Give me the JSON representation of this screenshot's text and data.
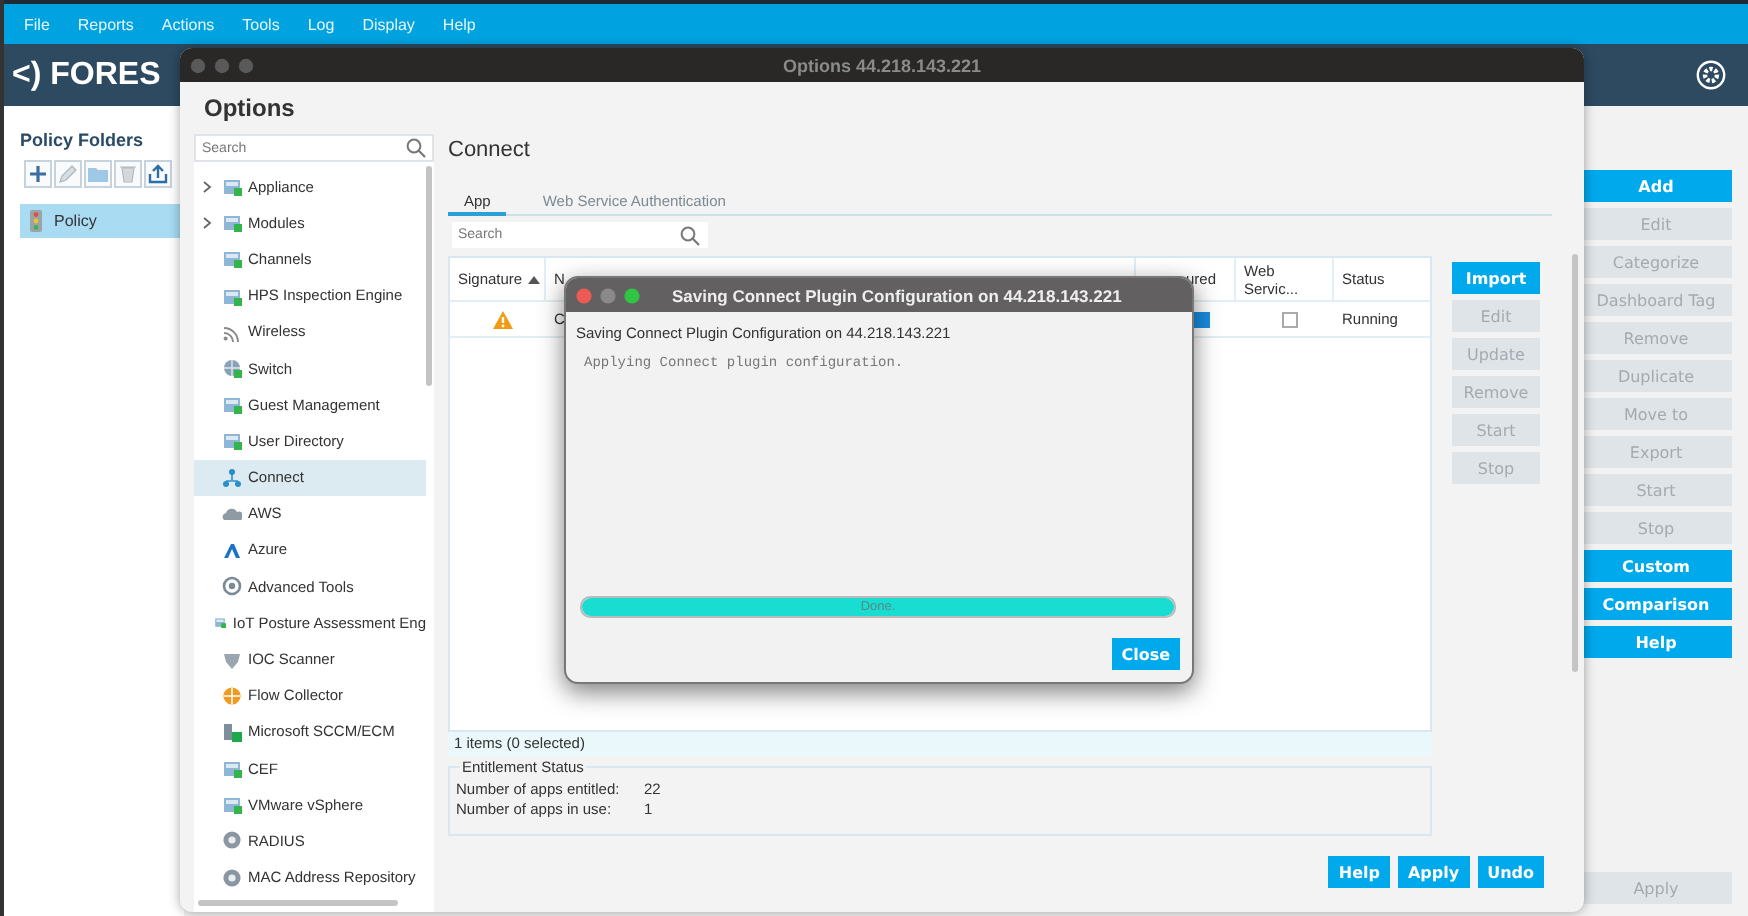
{
  "menu": [
    {
      "label": "File"
    },
    {
      "label": "Reports"
    },
    {
      "label": "Actions"
    },
    {
      "label": "Tools"
    },
    {
      "label": "Log"
    },
    {
      "label": "Display"
    },
    {
      "label": "Help"
    }
  ],
  "logo": "<) FORES",
  "policy_panel": {
    "title": "Policy Folders",
    "items": [
      {
        "label": "Policy",
        "selected": true
      }
    ]
  },
  "side_buttons": [
    {
      "label": "Add",
      "disabled": false
    },
    {
      "label": "Edit",
      "disabled": true
    },
    {
      "label": "Categorize",
      "disabled": true
    },
    {
      "label": "Dashboard Tag",
      "disabled": true
    },
    {
      "label": "Remove",
      "disabled": true
    },
    {
      "label": "Duplicate",
      "disabled": true
    },
    {
      "label": "Move to",
      "disabled": true
    },
    {
      "label": "Export",
      "disabled": true
    },
    {
      "label": "Start",
      "disabled": true
    },
    {
      "label": "Stop",
      "disabled": true
    },
    {
      "label": "Custom",
      "disabled": false
    },
    {
      "label": "Comparison",
      "disabled": false
    },
    {
      "label": "Help",
      "disabled": false
    }
  ],
  "apply_button": {
    "label": "Apply",
    "disabled": true
  },
  "options_window": {
    "title": "Options 44.218.143.221",
    "heading": "Options",
    "nav_search": {
      "placeholder": "Search"
    },
    "nav_items": [
      {
        "label": "Appliance",
        "expandable": true,
        "selected": false
      },
      {
        "label": "Modules",
        "expandable": true,
        "selected": false
      },
      {
        "label": "Channels",
        "expandable": false,
        "selected": false
      },
      {
        "label": "HPS Inspection Engine",
        "expandable": false,
        "selected": false
      },
      {
        "label": "Wireless",
        "expandable": false,
        "selected": false
      },
      {
        "label": "Switch",
        "expandable": false,
        "selected": false
      },
      {
        "label": "Guest Management",
        "expandable": false,
        "selected": false
      },
      {
        "label": "User Directory",
        "expandable": false,
        "selected": false
      },
      {
        "label": "Connect",
        "expandable": false,
        "selected": true
      },
      {
        "label": "AWS",
        "expandable": false,
        "selected": false
      },
      {
        "label": "Azure",
        "expandable": false,
        "selected": false
      },
      {
        "label": "Advanced Tools",
        "expandable": false,
        "selected": false
      },
      {
        "label": "IoT Posture Assessment Eng",
        "expandable": false,
        "selected": false
      },
      {
        "label": "IOC Scanner",
        "expandable": false,
        "selected": false
      },
      {
        "label": "Flow Collector",
        "expandable": false,
        "selected": false
      },
      {
        "label": "Microsoft SCCM/ECM",
        "expandable": false,
        "selected": false
      },
      {
        "label": "CEF",
        "expandable": false,
        "selected": false
      },
      {
        "label": "VMware vSphere",
        "expandable": false,
        "selected": false
      },
      {
        "label": "RADIUS",
        "expandable": false,
        "selected": false
      },
      {
        "label": "MAC Address Repository",
        "expandable": false,
        "selected": false
      }
    ],
    "section_title": "Connect",
    "tabs": [
      {
        "label": "App",
        "selected": true
      },
      {
        "label": "Web Service Authentication",
        "selected": false
      }
    ],
    "search": {
      "placeholder": "Search"
    },
    "table": {
      "columns": [
        {
          "label": "Signature"
        },
        {
          "label": "N"
        },
        {
          "label": "ured"
        },
        {
          "label": "Web Servic..."
        },
        {
          "label": "Status"
        }
      ],
      "rows": [
        {
          "name": "C",
          "configured": true,
          "web_service": false,
          "status": "Running"
        }
      ],
      "footer": "1 items (0 selected)"
    },
    "entitlement": {
      "title": "Entitlement Status",
      "rows": [
        {
          "label": "Number of apps entitled:",
          "value": "22"
        },
        {
          "label": "Number of apps in use:",
          "value": "1"
        }
      ]
    },
    "action_buttons": [
      {
        "label": "Import",
        "disabled": false
      },
      {
        "label": "Edit",
        "disabled": true
      },
      {
        "label": "Update",
        "disabled": true
      },
      {
        "label": "Remove",
        "disabled": true
      },
      {
        "label": "Start",
        "disabled": true
      },
      {
        "label": "Stop",
        "disabled": true
      }
    ],
    "bottom_buttons": [
      {
        "label": "Help"
      },
      {
        "label": "Apply"
      },
      {
        "label": "Undo"
      }
    ]
  },
  "dialog": {
    "title": "Saving Connect Plugin Configuration on 44.218.143.221",
    "subtitle": "Saving Connect Plugin Configuration on 44.218.143.221",
    "message": "Applying Connect plugin configuration.",
    "progress": {
      "level": 1,
      "label": "Done."
    },
    "close_button": "Close"
  }
}
